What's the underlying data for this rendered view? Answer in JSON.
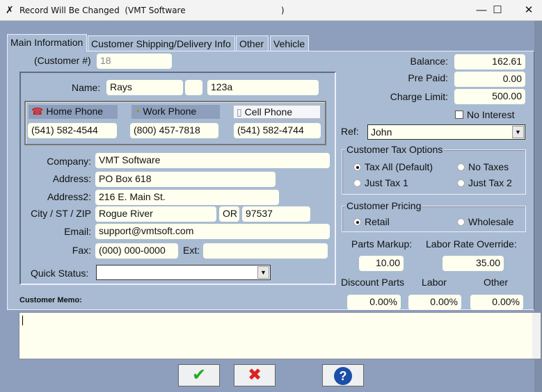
{
  "window": {
    "title": "Record Will Be Changed  (VMT Software                                    )",
    "minimize": "—",
    "maximize": "☐",
    "close": "✕"
  },
  "tabs": [
    "Main Information",
    "Customer Shipping/Delivery Info",
    "Other",
    "Vehicle"
  ],
  "customer": {
    "number_label": "(Customer #)",
    "number": "18",
    "name_label": "Name:",
    "first": "Rays",
    "middle": "",
    "last": "123a",
    "home_phone_label": "Home Phone",
    "work_phone_label": "Work Phone",
    "cell_phone_label": "Cell Phone",
    "home_phone": "(541) 582-4544",
    "work_phone": "(800) 457-7818",
    "cell_phone": "(541) 582-4744",
    "company_label": "Company:",
    "company": "VMT Software",
    "address_label": "Address:",
    "address": "PO Box 618",
    "address2_label": "Address2:",
    "address2": "216 E. Main St.",
    "city_label": "City / ST / ZIP",
    "city": "Rogue River",
    "state": "OR",
    "zip": "97537",
    "email_label": "Email:",
    "email": "support@vmtsoft.com",
    "fax_label": "Fax:",
    "fax": "(000) 000-0000",
    "ext_label": "Ext:",
    "ext": "",
    "quick_status_label": "Quick Status:",
    "quick_status": ""
  },
  "account": {
    "balance_label": "Balance:",
    "balance": "162.61",
    "prepaid_label": "Pre Paid:",
    "prepaid": "0.00",
    "charge_limit_label": "Charge Limit:",
    "charge_limit": "500.00",
    "no_interest_label": "No Interest",
    "no_interest": false,
    "ref_label": "Ref:",
    "ref": "John"
  },
  "tax": {
    "legend": "Customer Tax Options",
    "options": [
      "Tax All (Default)",
      "No Taxes",
      "Just Tax 1",
      "Just Tax 2"
    ],
    "selected": "Tax All (Default)"
  },
  "pricing": {
    "legend": "Customer Pricing",
    "options": [
      "Retail",
      "Wholesale"
    ],
    "selected": "Retail"
  },
  "rates": {
    "parts_markup_label": "Parts Markup:",
    "parts_markup": "10.00",
    "labor_rate_label": "Labor Rate Override:",
    "labor_rate": "35.00",
    "discount_parts_label": "Discount Parts",
    "discount_parts": "0.00%",
    "labor_label": "Labor",
    "labor": "0.00%",
    "other_label": "Other",
    "other": "0.00%"
  },
  "memo": {
    "label": "Customer Memo:",
    "value": ""
  },
  "buttons": {
    "ok": "✔",
    "cancel": "✖",
    "help": "?"
  }
}
